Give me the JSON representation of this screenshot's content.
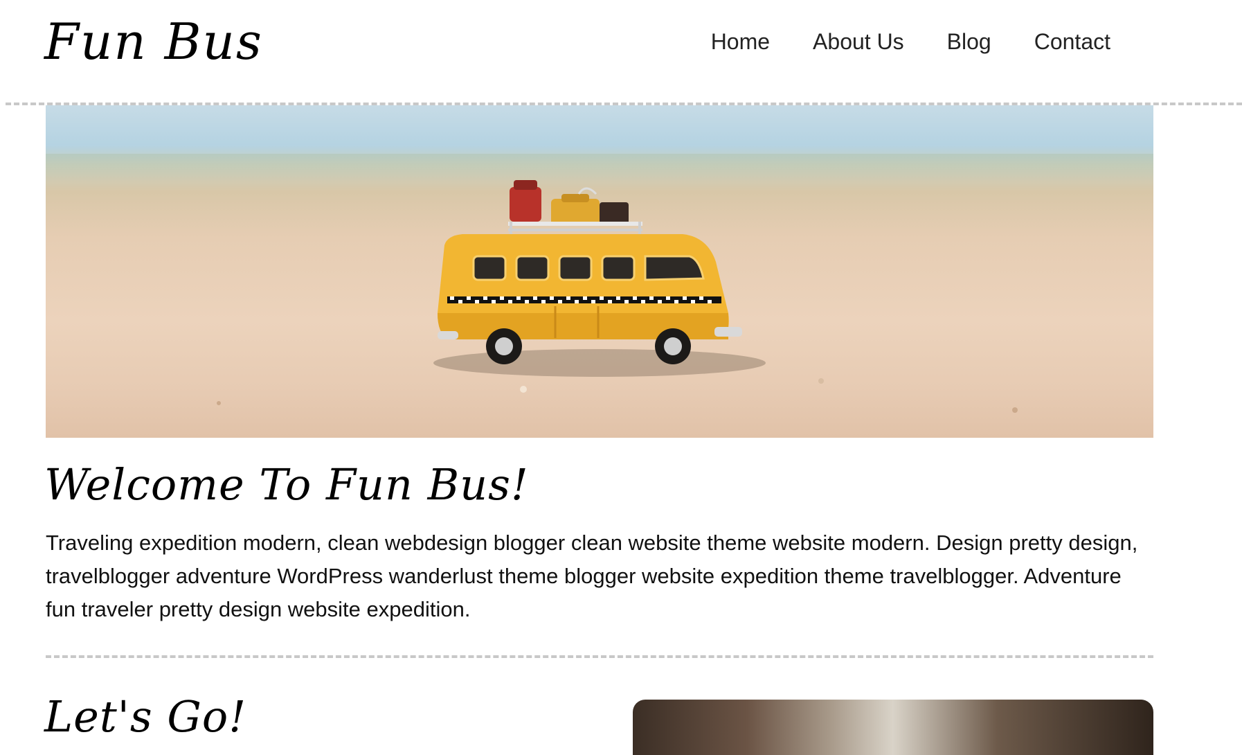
{
  "header": {
    "logo": "Fun Bus",
    "nav": [
      "Home",
      "About Us",
      "Blog",
      "Contact"
    ]
  },
  "hero": {
    "image": "toy-yellow-bus-on-beach"
  },
  "welcome": {
    "title": "Welcome To Fun Bus!",
    "body": "Traveling expedition modern, clean webdesign blogger clean website theme website modern. Design pretty design, travelblogger adventure WordPress wanderlust theme blogger website expedition theme travelblogger. Adventure fun traveler pretty design website expedition."
  },
  "next_section": {
    "title": "Let's Go!",
    "image": "coffee-cup-hands-photo"
  },
  "colors": {
    "divider": "#c8c8c8",
    "text": "#111111",
    "bus_yellow": "#f2b632"
  }
}
